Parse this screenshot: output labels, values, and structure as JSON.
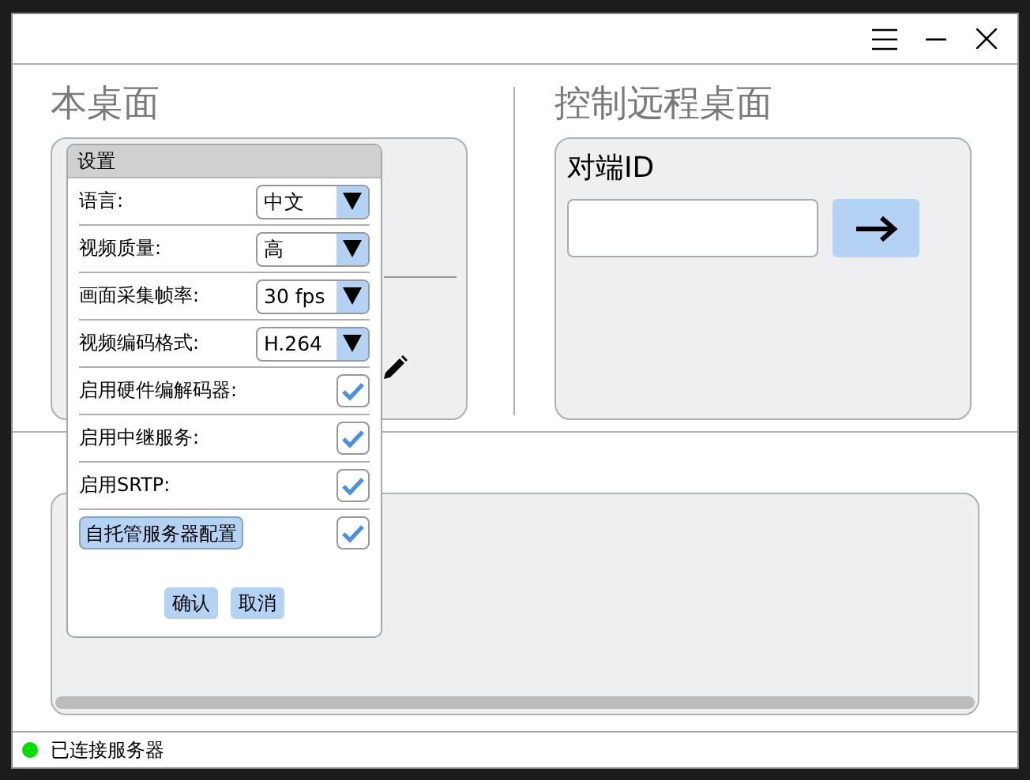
{
  "local_desktop": {
    "heading": "本桌面"
  },
  "remote_desktop": {
    "heading": "控制远程桌面",
    "peer_id_label": "对端ID"
  },
  "settings_dialog": {
    "title": "设置",
    "rows": [
      {
        "kind": "select",
        "label": "语言:",
        "value": "中文"
      },
      {
        "kind": "select",
        "label": "视频质量:",
        "value": "高"
      },
      {
        "kind": "select",
        "label": "画面采集帧率:",
        "value": "30 fps"
      },
      {
        "kind": "select",
        "label": "视频编码格式:",
        "value": "H.264"
      },
      {
        "kind": "checkbox",
        "label": "启用硬件编解码器:",
        "checked": true
      },
      {
        "kind": "checkbox",
        "label": "启用中继服务:",
        "checked": true
      },
      {
        "kind": "checkbox",
        "label": "启用SRTP:",
        "checked": true
      },
      {
        "kind": "button-check",
        "label": "自托管服务器配置",
        "checked": true
      }
    ],
    "buttons": [
      "确认",
      "取消"
    ]
  },
  "status_bar": {
    "text": "已连接服务器",
    "connected": true
  }
}
